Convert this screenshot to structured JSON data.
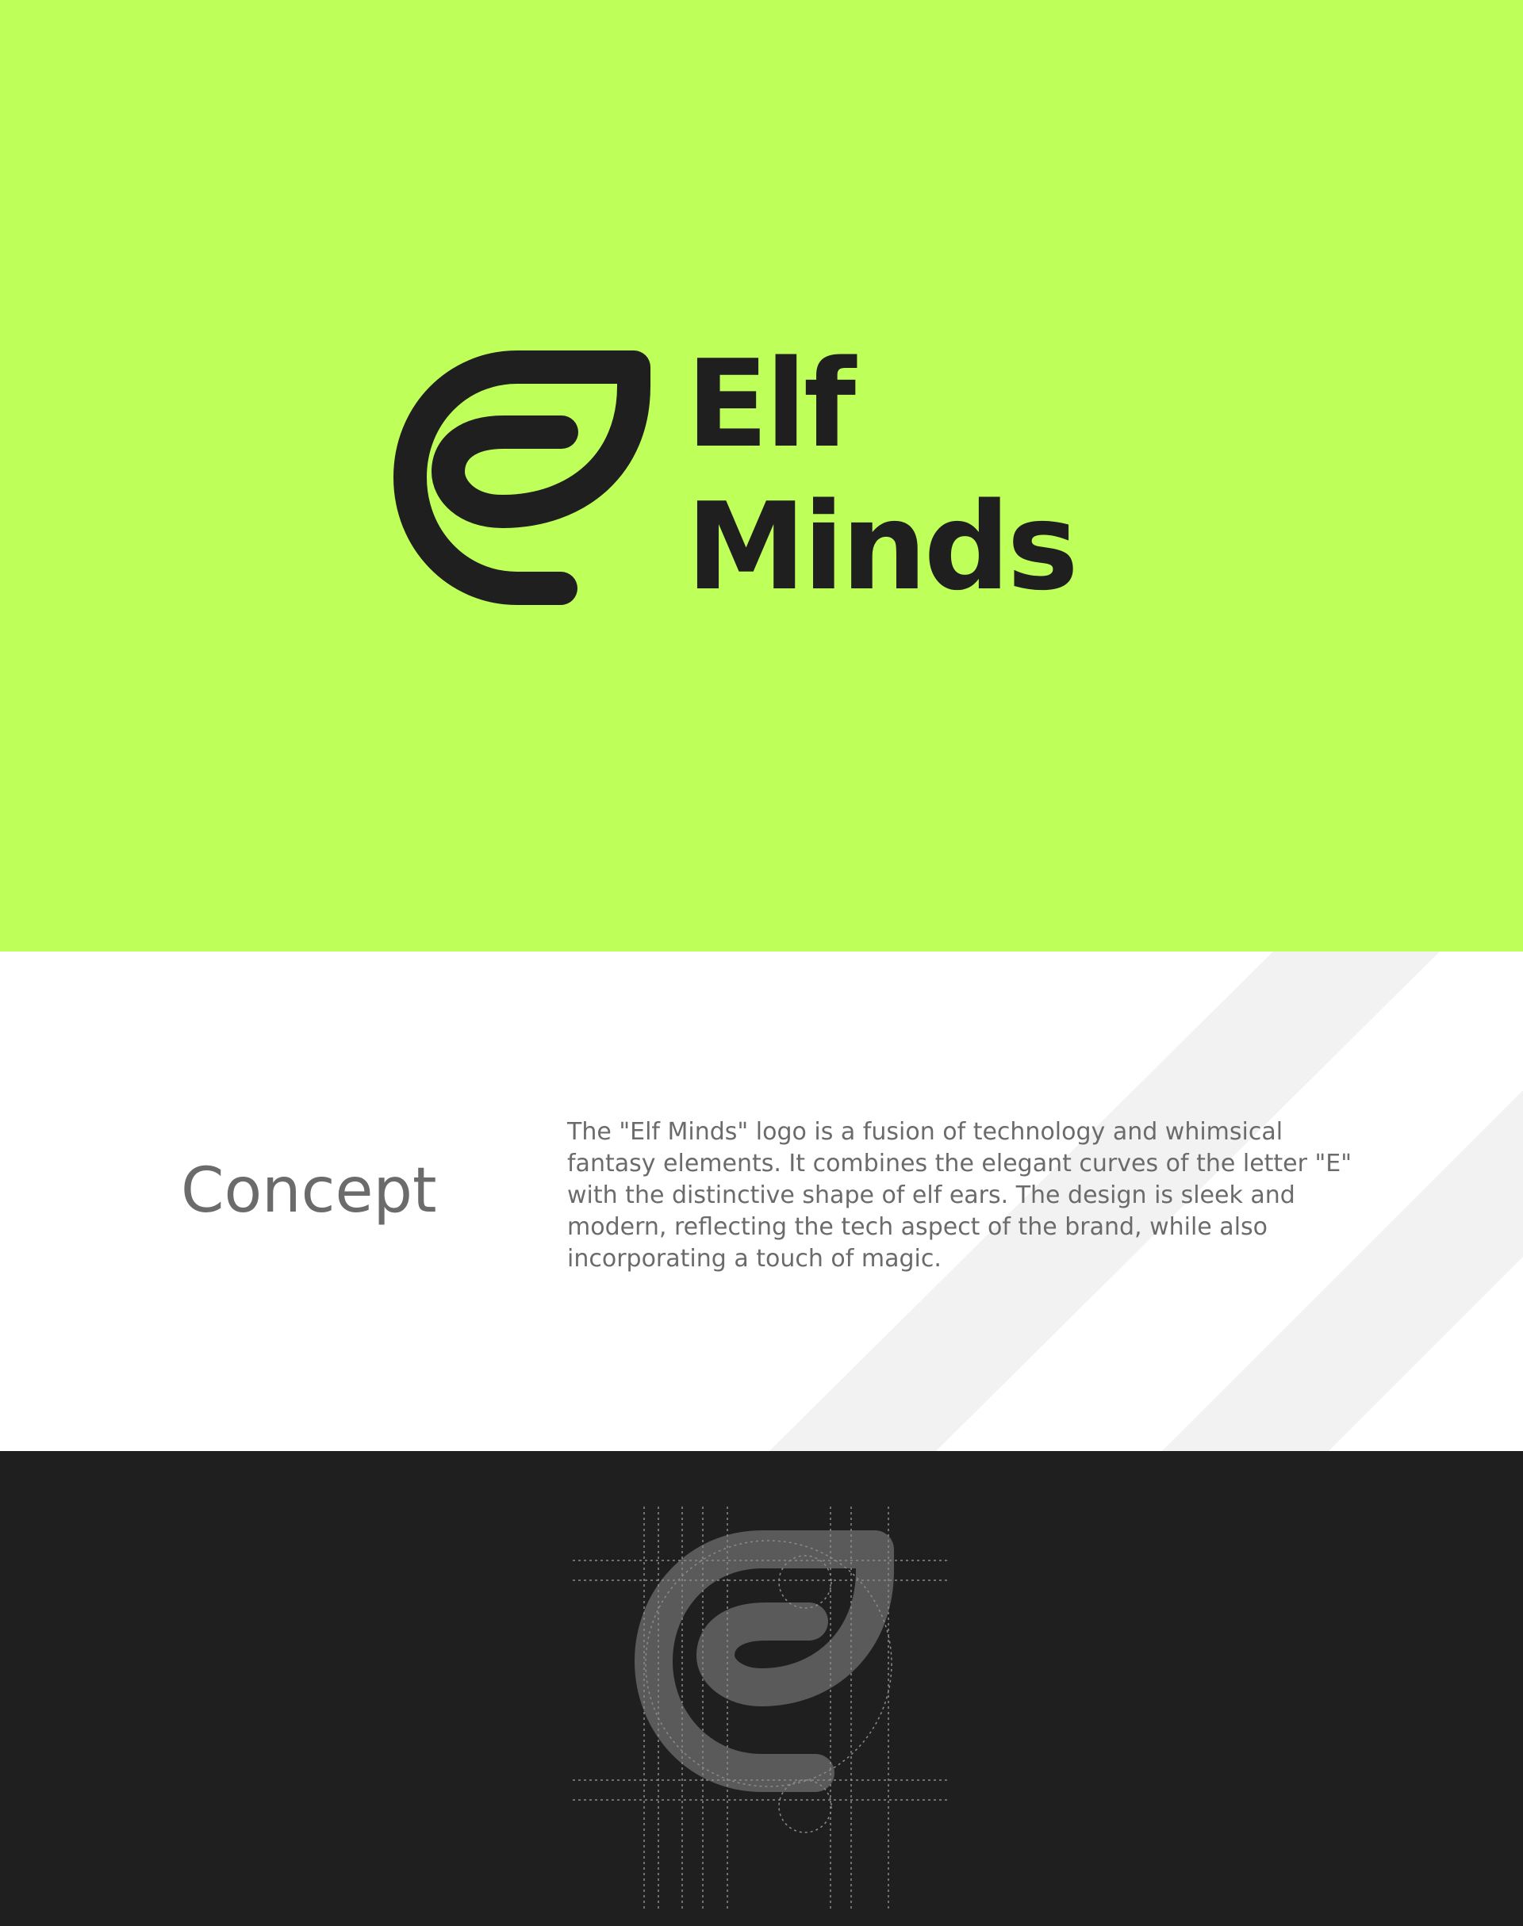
{
  "brand": {
    "wordmark_line1": "Elf",
    "wordmark_line2": "Minds",
    "logo_icon": "elf-ear-letter-e-icon"
  },
  "concept": {
    "heading": "Concept",
    "body": "The \"Elf Minds\" logo is a fusion of technology and whimsical fantasy elements. It combines the elegant curves of the letter \"E\" with the distinctive shape of elf ears. The design is sleek and modern, reflecting the tech aspect of the brand, while also incorporating a touch of magic."
  },
  "construction": {
    "graphic": "logo-construction-grid"
  },
  "colors": {
    "brand_green": "#bfff5a",
    "ink": "#1f1f1f",
    "concept_text": "#6b6b6b",
    "stripe": "#f2f2f2",
    "dark_panel": "#1f1f1f",
    "construction_mark": "#5a5a5a",
    "grid_line": "#8a8a8a"
  }
}
